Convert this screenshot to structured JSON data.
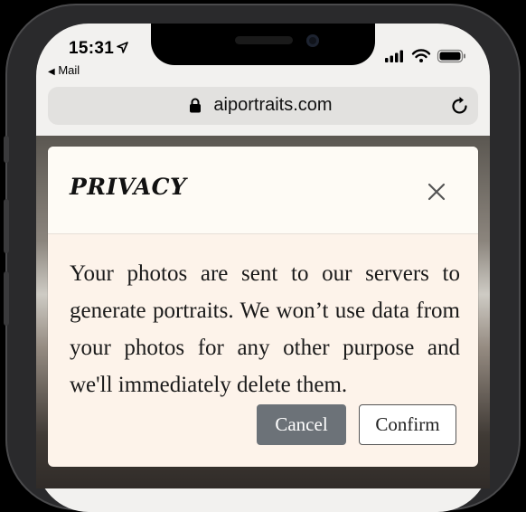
{
  "status_bar": {
    "time": "15:31",
    "back_app": "Mail"
  },
  "browser": {
    "url": "aiportraits.com"
  },
  "modal": {
    "title": "PRIVACY",
    "body": "Your photos are sent to our servers to generate portraits. We won’t use data from your photos for any other purpose and we'll immediately delete them.",
    "cancel_label": "Cancel",
    "confirm_label": "Confirm"
  },
  "colors": {
    "cancel_bg": "#6c7278",
    "modal_bg": "#fdf3ea"
  },
  "icons": [
    "location-arrow-icon",
    "back-arrow-icon",
    "signal-icon",
    "wifi-icon",
    "battery-icon",
    "lock-icon",
    "reload-icon",
    "close-icon"
  ]
}
